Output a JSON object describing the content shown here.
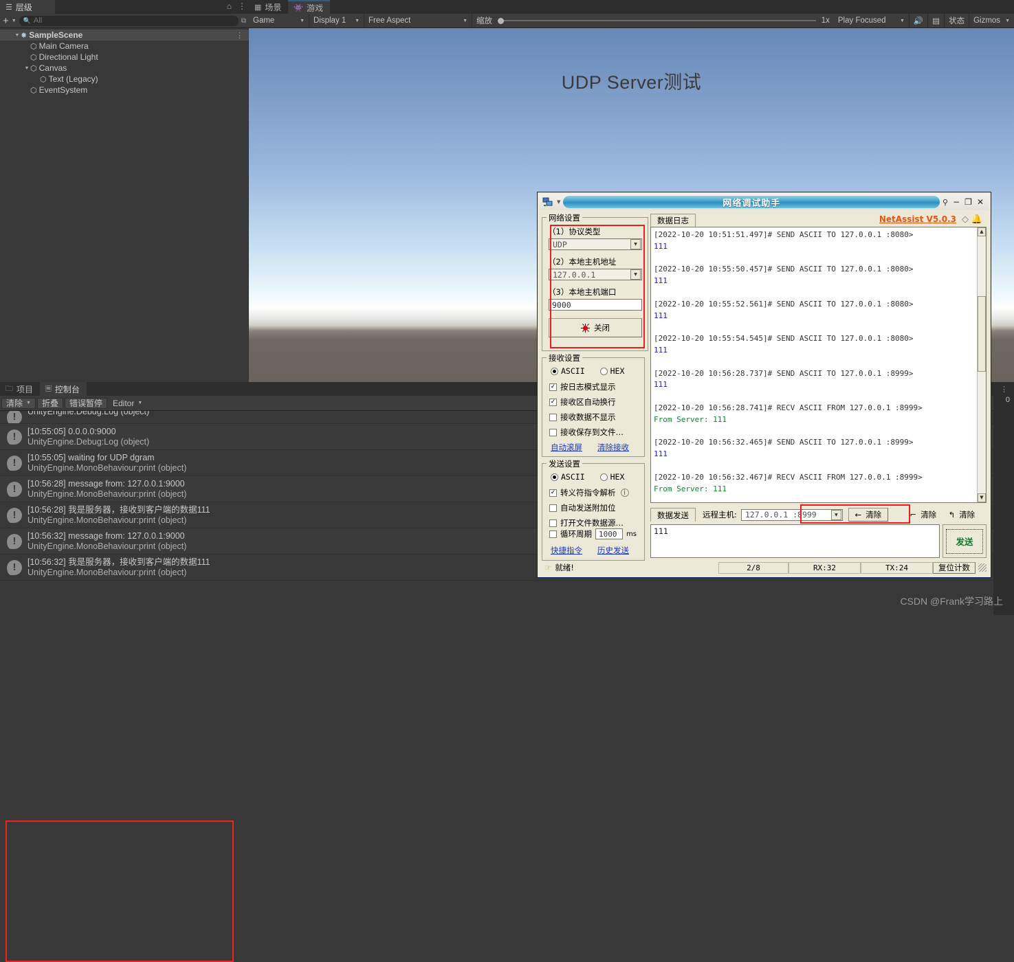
{
  "unity": {
    "hierarchy": {
      "tab_label": "层级",
      "tab_icon": "hierarchy-icon",
      "lock_icon": "lock-icon",
      "menu_icon": "kebab-menu-icon",
      "add_label": "+",
      "search_placeholder": "All",
      "items": [
        {
          "label": "SampleScene",
          "depth": 0,
          "expanded": true,
          "selected": true,
          "is_scene": true
        },
        {
          "label": "Main Camera",
          "depth": 1,
          "expanded": false,
          "selected": false,
          "is_scene": false
        },
        {
          "label": "Directional Light",
          "depth": 1,
          "expanded": false,
          "selected": false,
          "is_scene": false
        },
        {
          "label": "Canvas",
          "depth": 1,
          "expanded": true,
          "selected": false,
          "is_scene": false
        },
        {
          "label": "Text (Legacy)",
          "depth": 2,
          "expanded": false,
          "selected": false,
          "is_scene": false
        },
        {
          "label": "EventSystem",
          "depth": 1,
          "expanded": false,
          "selected": false,
          "is_scene": false
        }
      ]
    },
    "gameview": {
      "tab_scene": "场景",
      "tab_game": "游戏",
      "mode": "Game",
      "display": "Display 1",
      "aspect": "Free Aspect",
      "scale_label": "缩放",
      "scale_value": "1x",
      "play_focused": "Play Focused",
      "mute_icon": "speaker-icon",
      "stats_icon": "stats-icon",
      "stats_label": "状态",
      "gizmos_label": "Gizmos",
      "canvas_title": "UDP Server测试"
    },
    "console": {
      "tab_project": "项目",
      "tab_console": "控制台",
      "clear": "清除",
      "collapse": "折叠",
      "error_pause": "错误暂停",
      "editor": "Editor",
      "sliver_number": "0",
      "entries": [
        {
          "line1": "UnityEngine.Debug:Log (object)",
          "line2": "",
          "clipped": true
        },
        {
          "line1": "[10:55:05] 0.0.0.0:9000",
          "line2": "UnityEngine.Debug:Log (object)",
          "clipped": false
        },
        {
          "line1": "[10:55:05] waiting for UDP dgram",
          "line2": "UnityEngine.MonoBehaviour:print (object)",
          "clipped": false
        },
        {
          "line1": "[10:56:28] message from: 127.0.0.1:9000",
          "line2": "UnityEngine.MonoBehaviour:print (object)",
          "clipped": false
        },
        {
          "line1": "[10:56:28] 我是服务器，接收到客户端的数据111",
          "line2": "UnityEngine.MonoBehaviour:print (object)",
          "clipped": false
        },
        {
          "line1": "[10:56:32] message from: 127.0.0.1:9000",
          "line2": "UnityEngine.MonoBehaviour:print (object)",
          "clipped": false
        },
        {
          "line1": "[10:56:32] 我是服务器，接收到客户端的数据111",
          "line2": "UnityEngine.MonoBehaviour:print (object)",
          "clipped": false
        }
      ]
    },
    "watermark": "CSDN @Frank学习路上"
  },
  "netassist": {
    "title": "网络调试助手",
    "version": "NetAssist V5.0.3",
    "minimize": "−",
    "maximize": "❐",
    "close": "✕",
    "pin_icon": "pin-icon",
    "sys_icon": "app-icon",
    "gem_icon": "diamond-icon",
    "bell_icon": "bell-icon",
    "network_settings": {
      "legend": "网络设置",
      "protocol_label": "（1）协议类型",
      "protocol_value": "UDP",
      "host_label": "（2）本地主机地址",
      "host_value": "127.0.0.1",
      "port_label": "（3）本地主机端口",
      "port_value": "9000",
      "action_button": "关闭"
    },
    "recv_settings": {
      "legend": "接收设置",
      "ascii": "ASCII",
      "hex": "HEX",
      "mode": "ascii",
      "checks": [
        {
          "label": "按日志模式显示",
          "checked": true
        },
        {
          "label": "接收区自动换行",
          "checked": true
        },
        {
          "label": "接收数据不显示",
          "checked": false
        },
        {
          "label": "接收保存到文件…",
          "checked": false
        }
      ],
      "link_autoscroll": "自动滚屏",
      "link_clear": "清除接收"
    },
    "send_settings": {
      "legend": "发送设置",
      "ascii": "ASCII",
      "hex": "HEX",
      "mode": "ascii",
      "checks": [
        {
          "label": "转义符指令解析",
          "checked": true,
          "info": true
        },
        {
          "label": "自动发送附加位",
          "checked": false,
          "info": false
        },
        {
          "label": "打开文件数据源…",
          "checked": false,
          "info": false
        }
      ],
      "loop_label": "循环周期",
      "loop_checked": false,
      "loop_value": "1000",
      "loop_unit": "ms",
      "link_quick": "快捷指令",
      "link_history": "历史发送"
    },
    "log": {
      "tab_label": "数据日志",
      "lines": [
        {
          "text": "[2022-10-20 10:51:51.497]# SEND ASCII TO 127.0.0.1 :8080>",
          "kind": "hdr"
        },
        {
          "text": "111",
          "kind": "snd"
        },
        {
          "text": "",
          "kind": "hdr"
        },
        {
          "text": "[2022-10-20 10:55:50.457]# SEND ASCII TO 127.0.0.1 :8080>",
          "kind": "hdr"
        },
        {
          "text": "111",
          "kind": "snd"
        },
        {
          "text": "",
          "kind": "hdr"
        },
        {
          "text": "[2022-10-20 10:55:52.561]# SEND ASCII TO 127.0.0.1 :8080>",
          "kind": "hdr"
        },
        {
          "text": "111",
          "kind": "snd"
        },
        {
          "text": "",
          "kind": "hdr"
        },
        {
          "text": "[2022-10-20 10:55:54.545]# SEND ASCII TO 127.0.0.1 :8080>",
          "kind": "hdr"
        },
        {
          "text": "111",
          "kind": "snd"
        },
        {
          "text": "",
          "kind": "hdr"
        },
        {
          "text": "[2022-10-20 10:56:28.737]# SEND ASCII TO 127.0.0.1 :8999>",
          "kind": "hdr"
        },
        {
          "text": "111",
          "kind": "snd"
        },
        {
          "text": "",
          "kind": "hdr"
        },
        {
          "text": "[2022-10-20 10:56:28.741]# RECV ASCII FROM 127.0.0.1 :8999>",
          "kind": "hdr"
        },
        {
          "text": "From Server: 111",
          "kind": "rcv"
        },
        {
          "text": "",
          "kind": "hdr"
        },
        {
          "text": "[2022-10-20 10:56:32.465]# SEND ASCII TO 127.0.0.1 :8999>",
          "kind": "hdr"
        },
        {
          "text": "111",
          "kind": "snd"
        },
        {
          "text": "",
          "kind": "hdr"
        },
        {
          "text": "[2022-10-20 10:56:32.467]# RECV ASCII FROM 127.0.0.1 :8999>",
          "kind": "hdr"
        },
        {
          "text": "From Server: 111",
          "kind": "rcv"
        }
      ]
    },
    "send_bar": {
      "tab_label": "数据发送",
      "remote_label": "远程主机:",
      "remote_value": "127.0.0.1 :8999",
      "clear_back": "清除",
      "clear_down": "清除",
      "clear_up": "清除",
      "message": "111",
      "send_button": "发送"
    },
    "status": {
      "ready": "就绪!",
      "conn": "2/8",
      "rx": "RX:32",
      "tx": "TX:24",
      "reset": "复位计数"
    }
  }
}
